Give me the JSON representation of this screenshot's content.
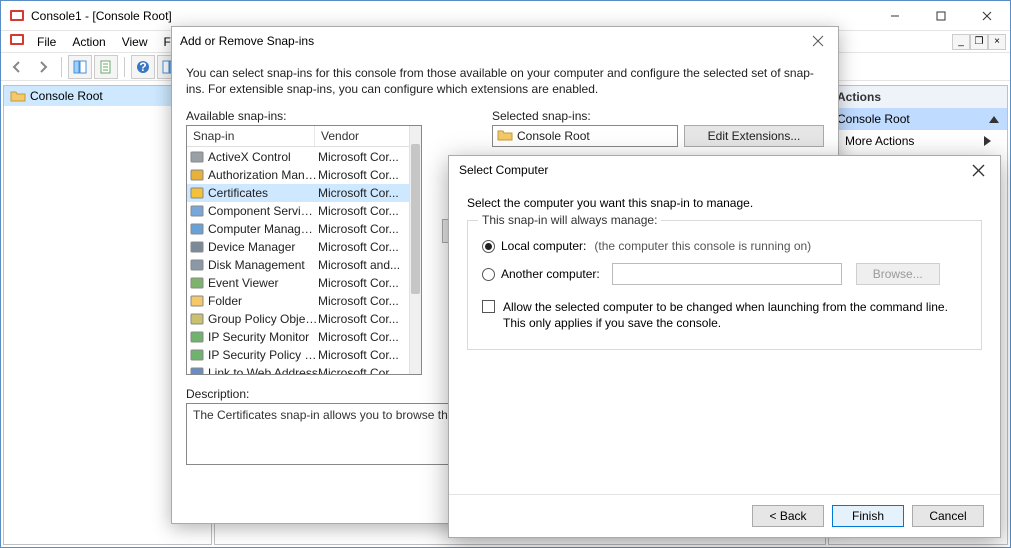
{
  "window": {
    "title": "Console1 - [Console Root]",
    "menus": [
      "File",
      "Action",
      "View",
      "Favorites"
    ],
    "tree_root": "Console Root"
  },
  "actions": {
    "header": "Actions",
    "selected": "Console Root",
    "item": "More Actions"
  },
  "snapin": {
    "title": "Add or Remove Snap-ins",
    "intro": "You can select snap-ins for this console from those available on your computer and configure the selected set of snap-ins. For extensible snap-ins, you can configure which extensions are enabled.",
    "available_label": "Available snap-ins:",
    "selected_label": "Selected snap-ins:",
    "col_snapin": "Snap-in",
    "col_vendor": "Vendor",
    "selected_root": "Console Root",
    "edit_ext_btn": "Edit Extensions...",
    "desc_label": "Description:",
    "desc_text": "The Certificates snap-in allows you to browse the cont",
    "rows": [
      {
        "name": "ActiveX Control",
        "vendor": "Microsoft Cor..."
      },
      {
        "name": "Authorization Manager",
        "vendor": "Microsoft Cor..."
      },
      {
        "name": "Certificates",
        "vendor": "Microsoft Cor...",
        "selected": true
      },
      {
        "name": "Component Services",
        "vendor": "Microsoft Cor..."
      },
      {
        "name": "Computer Managem...",
        "vendor": "Microsoft Cor..."
      },
      {
        "name": "Device Manager",
        "vendor": "Microsoft Cor..."
      },
      {
        "name": "Disk Management",
        "vendor": "Microsoft and..."
      },
      {
        "name": "Event Viewer",
        "vendor": "Microsoft Cor..."
      },
      {
        "name": "Folder",
        "vendor": "Microsoft Cor..."
      },
      {
        "name": "Group Policy Object ...",
        "vendor": "Microsoft Cor..."
      },
      {
        "name": "IP Security Monitor",
        "vendor": "Microsoft Cor..."
      },
      {
        "name": "IP Security Policy M...",
        "vendor": "Microsoft Cor..."
      },
      {
        "name": "Link to Web Address",
        "vendor": "Microsoft Cor..."
      }
    ]
  },
  "selc": {
    "title": "Select Computer",
    "intro": "Select the computer you want this snap-in to manage.",
    "group_legend": "This snap-in will always manage:",
    "local_label": "Local computer:",
    "local_hint": "(the computer this console is running on)",
    "another_label": "Another computer:",
    "browse_btn": "Browse...",
    "allow_text": "Allow the selected computer to be changed when launching from the command line.  This only applies if you save the console.",
    "back_btn": "< Back",
    "finish_btn": "Finish",
    "cancel_btn": "Cancel"
  }
}
